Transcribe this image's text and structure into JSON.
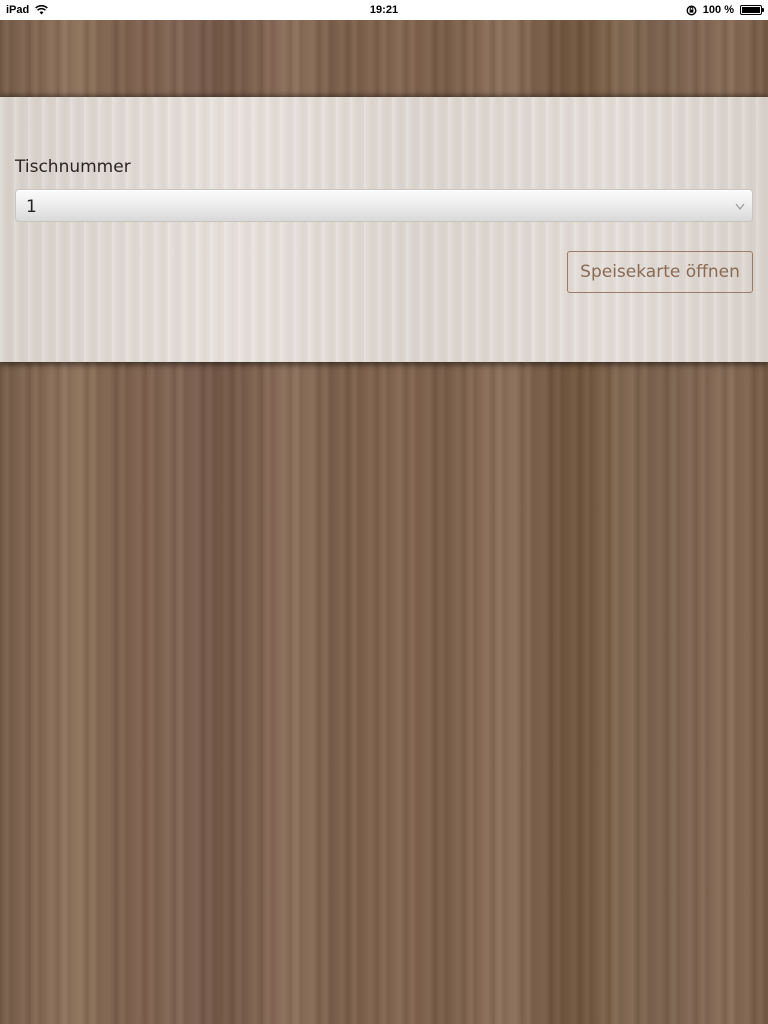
{
  "status_bar": {
    "device": "iPad",
    "time": "19:21",
    "battery_percent": "100 %",
    "battery_level": 1.0,
    "icons": [
      "wifi-icon",
      "orientation-lock-icon",
      "battery-icon"
    ]
  },
  "form": {
    "table_label": "Tischnummer",
    "table_select_value": "1",
    "open_menu_label": "Speisekarte öffnen"
  },
  "colors": {
    "button_text": "#8a6a52",
    "button_border": "#9a7d68",
    "panel_background": "#ddd6d0",
    "wood_background": "#7b5f49"
  }
}
